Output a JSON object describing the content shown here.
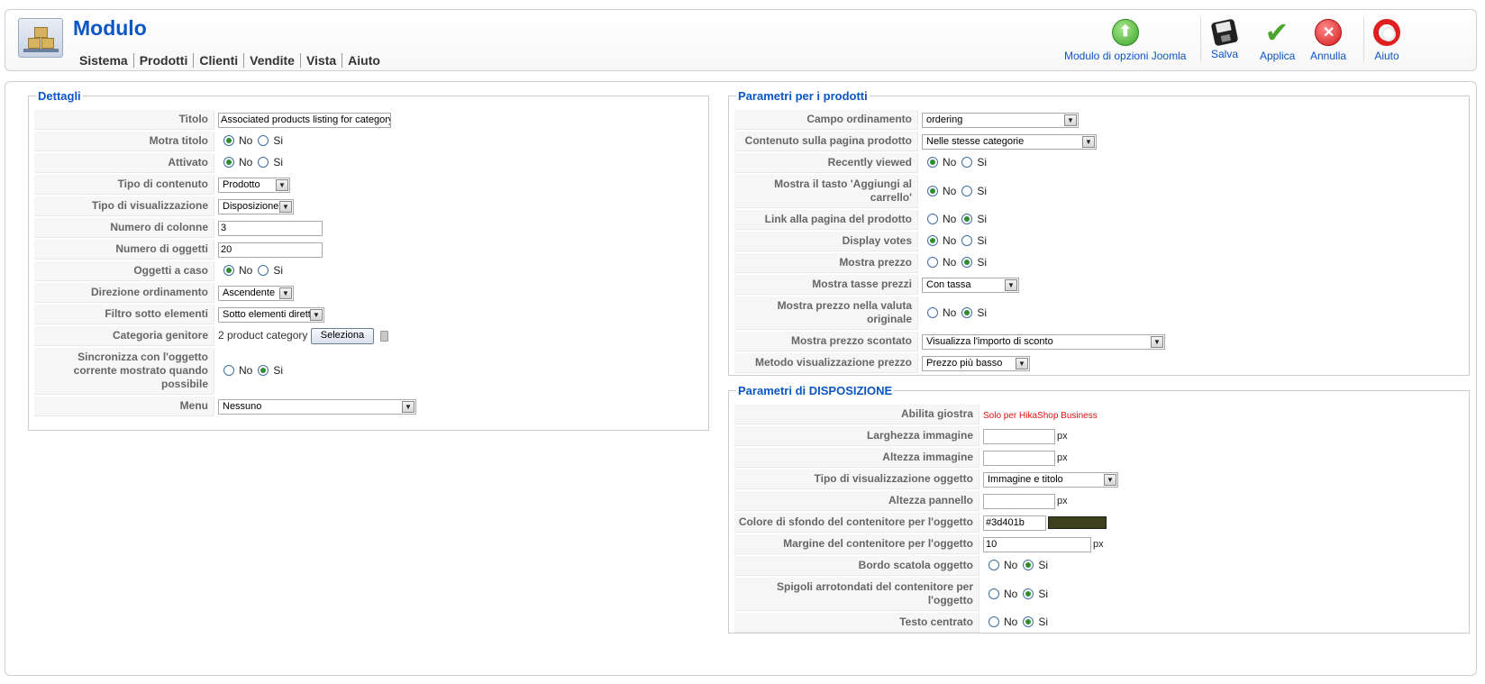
{
  "header": {
    "title": "Modulo",
    "menu": [
      "Sistema",
      "Prodotti",
      "Clienti",
      "Vendite",
      "Vista",
      "Aiuto"
    ]
  },
  "toolbar": {
    "options_label": "Modulo di opzioni Joomla",
    "save_label": "Salva",
    "apply_label": "Applica",
    "cancel_label": "Annulla",
    "help_label": "Aiuto"
  },
  "radio": {
    "no": "No",
    "si": "Si"
  },
  "details": {
    "legend": "Dettagli",
    "rows": {
      "titolo": {
        "label": "Titolo",
        "value": "Associated products listing for category listing"
      },
      "mostra_titolo": {
        "label": "Motra titolo",
        "selected": "No"
      },
      "attivato": {
        "label": "Attivato",
        "selected": "No"
      },
      "tipo_contenuto": {
        "label": "Tipo di contenuto",
        "value": "Prodotto"
      },
      "tipo_visualizzazione": {
        "label": "Tipo di visualizzazione",
        "value": "Disposizione"
      },
      "numero_colonne": {
        "label": "Numero di colonne",
        "value": "3"
      },
      "numero_oggetti": {
        "label": "Numero di oggetti",
        "value": "20"
      },
      "oggetti_caso": {
        "label": "Oggetti a caso",
        "selected": "No"
      },
      "direzione": {
        "label": "Direzione ordinamento",
        "value": "Ascendente"
      },
      "filtro": {
        "label": "Filtro sotto elementi",
        "value": "Sotto elementi diretti"
      },
      "categoria": {
        "label": "Categoria genitore",
        "value": "2 product category",
        "button": "Seleziona"
      },
      "sincronizza": {
        "label": "Sincronizza con l'oggetto corrente mostrato quando possibile",
        "selected": "Si"
      },
      "menu": {
        "label": "Menu",
        "value": "Nessuno"
      }
    }
  },
  "product_params": {
    "legend": "Parametri per i prodotti",
    "rows": {
      "campo_ordinamento": {
        "label": "Campo ordinamento",
        "value": "ordering"
      },
      "contenuto": {
        "label": "Contenuto sulla pagina prodotto",
        "value": "Nelle stesse categorie"
      },
      "recently": {
        "label": "Recently viewed",
        "selected": "No"
      },
      "carrello": {
        "label": "Mostra il tasto 'Aggiungi al carrello'",
        "selected": "No"
      },
      "link": {
        "label": "Link alla pagina del prodotto",
        "selected": "Si"
      },
      "votes": {
        "label": "Display votes",
        "selected": "No"
      },
      "prezzo": {
        "label": "Mostra prezzo",
        "selected": "Si"
      },
      "tasse": {
        "label": "Mostra tasse prezzi",
        "value": "Con tassa"
      },
      "valuta": {
        "label": "Mostra prezzo nella valuta originale",
        "selected": "Si"
      },
      "scontato": {
        "label": "Mostra prezzo scontato",
        "value": "Visualizza l'importo di sconto"
      },
      "metodo": {
        "label": "Metodo visualizzazione prezzo",
        "value": "Prezzo più basso"
      }
    }
  },
  "layout_params": {
    "legend": "Parametri di DISPOSIZIONE",
    "unit_px": "px",
    "rows": {
      "giostra": {
        "label": "Abilita giostra",
        "note": "Solo per HikaShop Business"
      },
      "larghezza": {
        "label": "Larghezza immagine",
        "value": ""
      },
      "altezza": {
        "label": "Altezza immagine",
        "value": ""
      },
      "tipo_vis_oggetto": {
        "label": "Tipo di visualizzazione oggetto",
        "value": "Immagine e titolo"
      },
      "altezza_pannello": {
        "label": "Altezza pannello",
        "value": ""
      },
      "colore_sfondo": {
        "label": "Colore di sfondo del contenitore per l'oggetto",
        "value": "#3d401b",
        "swatch_color": "#3d401b"
      },
      "margine": {
        "label": "Margine del contenitore per l'oggetto",
        "value": "10"
      },
      "bordo": {
        "label": "Bordo scatola oggetto",
        "selected": "Si"
      },
      "spigoli": {
        "label": "Spigoli arrotondati del contenitore per l'oggetto",
        "selected": "Si"
      },
      "centrato": {
        "label": "Testo centrato",
        "selected": "Si"
      }
    }
  },
  "colors": {
    "accent": "#0b55c4",
    "radio_dot": "#2f8d2f",
    "note_red": "#e01010"
  }
}
